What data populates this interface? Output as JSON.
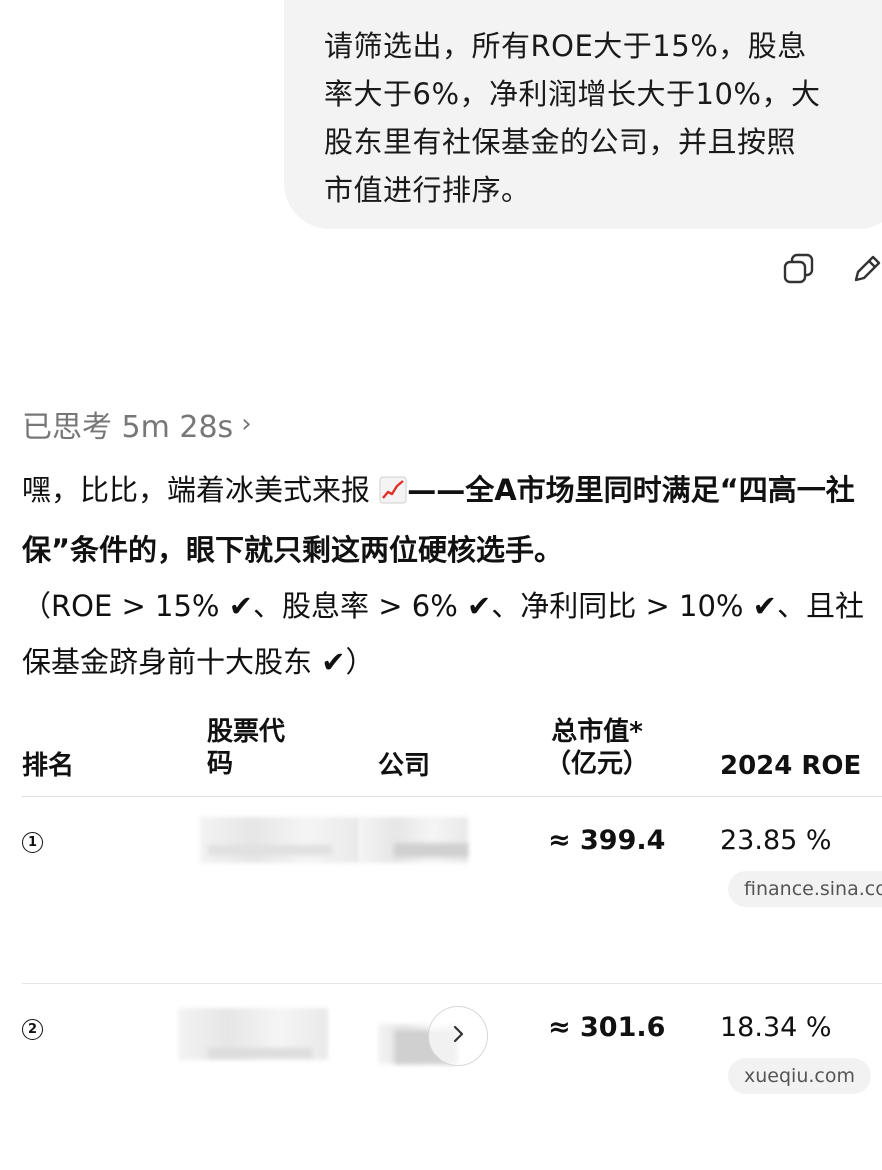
{
  "user_message": {
    "text": "请筛选出，所有ROE大于15%，股息\n率大于6%，净利润增长大于10%，大\n股东里有社保基金的公司，并且按照\n市值进行排序。"
  },
  "message_actions": {
    "copy_icon": "copy-icon",
    "edit_icon": "pencil-icon"
  },
  "thought": {
    "label": "已思考 5m 28s",
    "chevron": "›"
  },
  "answer": {
    "intro_plain": "嘿，比比，端着冰美式来报 ",
    "intro_emoji": "chart-increasing-emoji",
    "intro_bold": "——全A市场里同时满足“四高一社保”条件的，眼下就只剩这两位硬核选手。",
    "criteria": "（ROE > 15% ✔、股息率 > 6% ✔、净利同比 > 10% ✔、且社保基金跻身前十大股东 ✔）"
  },
  "table": {
    "headers": {
      "rank": "排名",
      "code": "股票代\n码",
      "company": "公司",
      "market_cap": "总市值*\n（亿元）",
      "roe": "2024 ROE"
    },
    "rows": [
      {
        "rank": "1",
        "market_cap": "≈ 399.4",
        "roe": "23.85 %",
        "source": "finance.sina.co..."
      },
      {
        "rank": "2",
        "market_cap": "≈ 301.6",
        "roe": "18.34 %",
        "source": "xueqiu.com"
      }
    ]
  },
  "colors": {
    "bubble_bg": "#f3f3f3",
    "muted_text": "#777777",
    "chip_bg": "#f2f2f2",
    "divider": "#dddddd"
  }
}
